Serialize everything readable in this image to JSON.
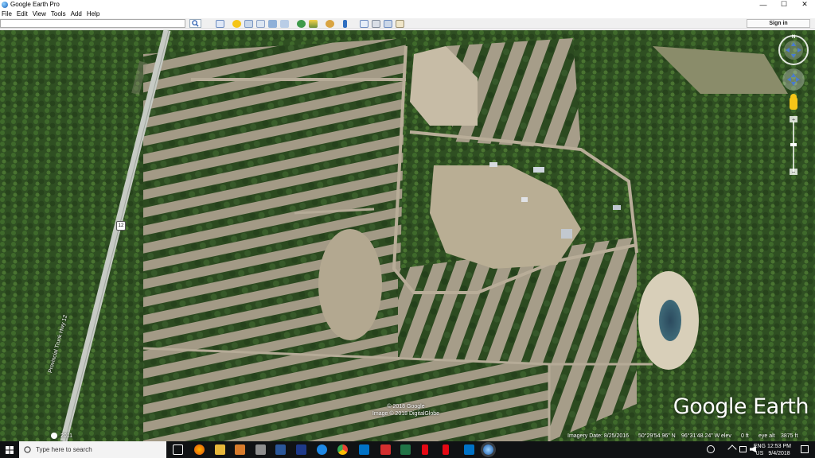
{
  "window": {
    "title": "Google Earth Pro",
    "controls": {
      "minimize": "—",
      "maximize": "☐",
      "close": "✕"
    }
  },
  "menu": {
    "items": [
      "File",
      "Edit",
      "View",
      "Tools",
      "Add",
      "Help"
    ]
  },
  "toolbar": {
    "search_value": "",
    "search_icon": "search-icon",
    "sign_in_label": "Sign in",
    "buttons": [
      "sidebar-toggle-icon",
      "placemark-icon",
      "polygon-icon",
      "path-icon",
      "image-overlay-icon",
      "tour-icon",
      "historical-imagery-icon",
      "sun-icon",
      "planets-icon",
      "ruler-icon",
      "email-icon",
      "print-icon",
      "save-image-icon",
      "maps-icon"
    ],
    "colors": {
      "accent": "#f5c518"
    }
  },
  "map": {
    "road_label": "Provincial Trunk Hwy 12",
    "highway_shield": "12",
    "copyright_lines": [
      "© 2018 Google",
      "Image © 2018 DigitalGlobe"
    ],
    "logo": "Google Earth",
    "status": {
      "year_badge": "2011",
      "imagery_date": "Imagery Date: 8/25/2016",
      "latitude": "50°29'54.96\" N",
      "longitude": "96°31'48.24\" W",
      "elev_label": "elev",
      "elev_value": "0 ft",
      "eye_alt_label": "eye alt",
      "eye_alt_value": "3875 ft"
    },
    "compass_north": "N"
  },
  "taskbar": {
    "search_placeholder": "Type here to search",
    "apps": [
      "task-view-icon",
      "firefox-icon",
      "file-explorer-icon",
      "app-icon",
      "calculator-icon",
      "word-icon",
      "app-grid-icon",
      "edge-icon",
      "chrome-icon",
      "outlook-icon",
      "flag-app-icon",
      "excel-icon",
      "netflix-icon",
      "outlook-icon-2",
      "google-earth-icon"
    ],
    "language": [
      "ENG",
      "US"
    ],
    "time": "12:53 PM",
    "date": "9/4/2018"
  }
}
